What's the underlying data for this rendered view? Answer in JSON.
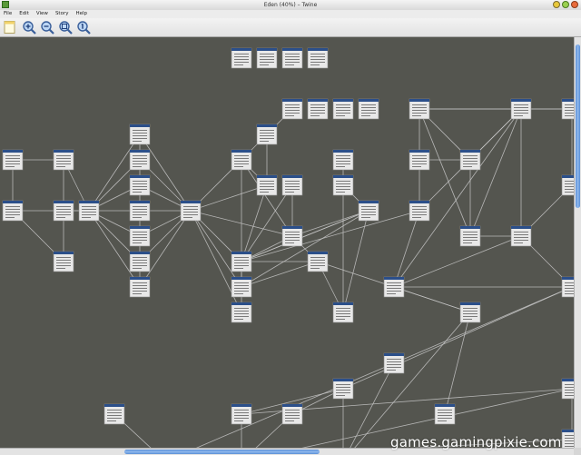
{
  "window": {
    "title": "Eden (40%) – Twine"
  },
  "menu": {
    "file": "File",
    "edit": "Edit",
    "view": "View",
    "story": "Story",
    "help": "Help"
  },
  "toolbar": {
    "new_passage_icon": "new-passage-icon",
    "zoom_in_icon": "zoom-in-icon",
    "zoom_out_icon": "zoom-out-icon",
    "zoom_fit_icon": "zoom-fit-icon",
    "zoom_actual_icon": "zoom-actual-icon"
  },
  "colors": {
    "canvas": "#54554f",
    "passage_header": "#2b4f8a",
    "passage_body": "#e8e8e8",
    "link": "#c8c8c8",
    "scroll_thumb": "#6d9ee0"
  },
  "watermark": "games.gamingpixie.com"
}
